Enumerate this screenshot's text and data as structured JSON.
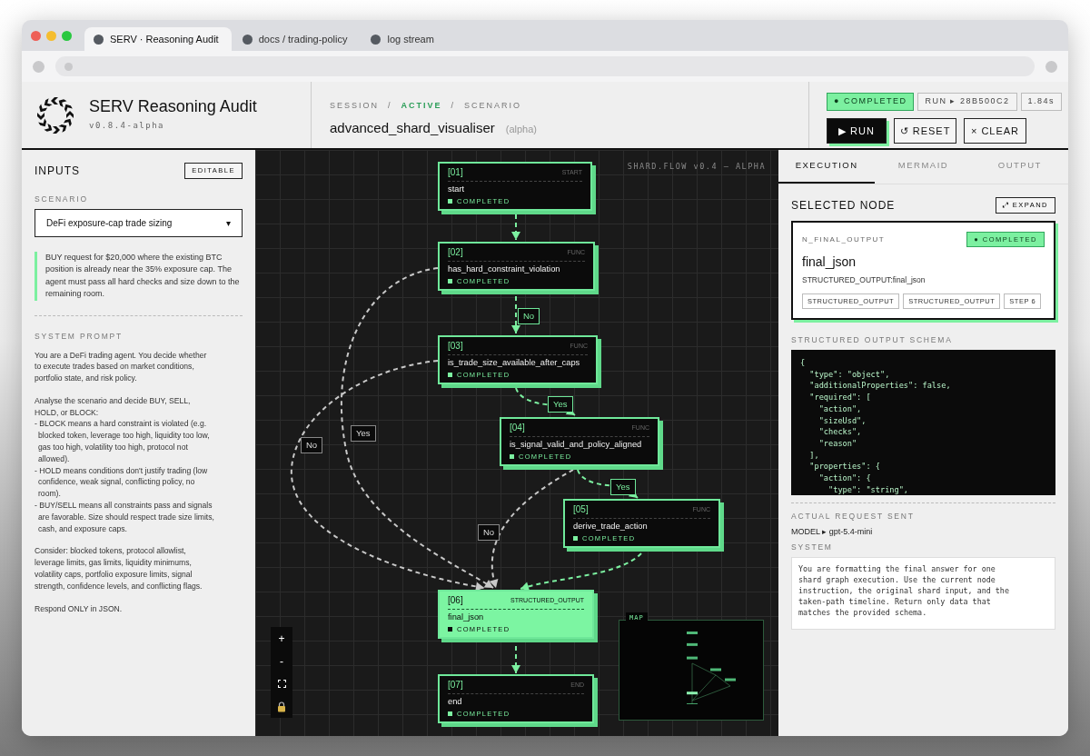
{
  "browser": {
    "tabs": [
      {
        "label": "SERV · Reasoning Audit",
        "selected": true
      },
      {
        "label": "docs / trading-policy",
        "selected": false
      },
      {
        "label": "log stream",
        "selected": false
      }
    ]
  },
  "header": {
    "title": "SERV Reasoning Audit",
    "version": "v0.8.4-alpha",
    "breadcrumb": [
      {
        "label": "SESSION",
        "active": false
      },
      {
        "label": "ACTIVE",
        "active": true
      },
      {
        "label": "SCENARIO",
        "active": false
      }
    ],
    "separator": "/",
    "scenario": "advanced_shard_visualiser",
    "scenario_tag": "(alpha)",
    "status": {
      "label": "● COMPLETED",
      "completed": true
    },
    "run_id": "RUN ▸ 28B500C2",
    "duration": "1.84s",
    "buttons": [
      {
        "kind": "primary",
        "label": "▶ RUN"
      },
      {
        "kind": "outline",
        "label": "↺ RESET"
      },
      {
        "kind": "outline",
        "label": "× CLEAR"
      }
    ]
  },
  "inputs": {
    "title": "INPUTS",
    "mode": "EDITABLE",
    "scenario_label": "SCENARIO",
    "scenario": "DeFi exposure-cap trade sizing",
    "caret": "▾",
    "description": "BUY request for $20,000 where the existing BTC position is already near the 35% exposure cap. The agent must pass all hard checks and size down to the remaining room.",
    "prompt_label": "SYSTEM PROMPT",
    "prompt": [
      {
        "kind": "text",
        "text": "You are a DeFi trading agent. You decide whether to execute trades based on market conditions, portfolio state, and risk policy."
      },
      {
        "kind": "text",
        "text": "Analyse the scenario and decide BUY, SELL, HOLD, or BLOCK:"
      },
      {
        "kind": "bullet",
        "text": "- BLOCK means a hard constraint is violated (e.g. blocked token, leverage too high, liquidity too low, gas too high, volatility too high, protocol not allowed)."
      },
      {
        "kind": "bullet",
        "text": "- HOLD means conditions don't justify trading (low confidence, weak signal, conflicting policy, no room)."
      },
      {
        "kind": "bullet",
        "text": "- BUY/SELL means all constraints pass and signals are favorable. Size should respect trade size limits, cash, and exposure caps."
      },
      {
        "kind": "text",
        "text": "Consider: blocked tokens, protocol allowlist, leverage limits, gas limits, liquidity minimums, volatility caps, portfolio exposure limits, signal strength, confidence levels, and conflicting flags."
      },
      {
        "kind": "text",
        "text": "Respond ONLY in JSON."
      }
    ]
  },
  "canvas": {
    "watermark": "SHARD.FLOW v0.4 — ALPHA",
    "nodes": [
      {
        "index": "[01]",
        "type": "START",
        "name": "start",
        "status": "COMPLETED",
        "completed": true,
        "selected": false
      },
      {
        "index": "[02]",
        "type": "FUNC",
        "name": "has_hard_constraint_violation",
        "status": "COMPLETED",
        "completed": true,
        "selected": false
      },
      {
        "index": "[03]",
        "type": "FUNC",
        "name": "is_trade_size_available_after_caps",
        "status": "COMPLETED",
        "completed": true,
        "selected": false
      },
      {
        "index": "[04]",
        "type": "FUNC",
        "name": "is_signal_valid_and_policy_aligned",
        "status": "COMPLETED",
        "completed": true,
        "selected": false
      },
      {
        "index": "[05]",
        "type": "FUNC",
        "name": "derive_trade_action",
        "status": "COMPLETED",
        "completed": true,
        "selected": false
      },
      {
        "index": "[06]",
        "type": "STRUCTURED_OUTPUT",
        "name": "final_json",
        "status": "COMPLETED",
        "completed": true,
        "selected": true
      },
      {
        "index": "[07]",
        "type": "END",
        "name": "end",
        "status": "COMPLETED",
        "completed": true,
        "selected": false
      }
    ],
    "edges": [
      {
        "taken": true
      },
      {
        "label": "No",
        "taken": true
      },
      {
        "label": "Yes",
        "taken": true
      },
      {
        "label": "Yes",
        "taken": true
      },
      {
        "taken": true
      },
      {
        "label": "Yes",
        "taken": false
      },
      {
        "label": "No",
        "taken": false
      },
      {
        "label": "No",
        "taken": false
      },
      {
        "taken": true
      }
    ],
    "controls": [
      {
        "kind": "zoom_in",
        "label": "+"
      },
      {
        "kind": "zoom_out",
        "label": "-"
      },
      {
        "kind": "fit"
      },
      {
        "kind": "lock"
      }
    ],
    "map_label": "MAP"
  },
  "panel": {
    "tabs": [
      {
        "label": "EXECUTION",
        "selected": true
      },
      {
        "label": "MERMAID",
        "selected": false
      },
      {
        "label": "OUTPUT",
        "selected": false
      }
    ],
    "heading": "SELECTED NODE",
    "expand": "⤢ EXPAND",
    "node": {
      "id": "N_FINAL_OUTPUT",
      "status": {
        "label": "● COMPLETED",
        "completed": true
      },
      "name": "final_json",
      "subtitle": "STRUCTURED_OUTPUT:final_json",
      "tags": [
        "STRUCTURED_OUTPUT",
        "STRUCTURED_OUTPUT",
        "STEP 6"
      ]
    },
    "schema_label": "STRUCTURED OUTPUT SCHEMA",
    "schema": "{\n  \"type\": \"object\",\n  \"additionalProperties\": false,\n  \"required\": [\n    \"action\",\n    \"sizeUsd\",\n    \"checks\",\n    \"reason\"\n  ],\n  \"properties\": {\n    \"action\": {\n      \"type\": \"string\",",
    "request_label": "ACTUAL REQUEST SENT",
    "model": "MODEL ▸ gpt-5.4-mini",
    "system_label": "SYSTEM",
    "system": "You are formatting the final answer for one shard graph execution. Use the current node instruction, the original shard input, and the taken-path timeline. Return only data that matches the provided schema."
  }
}
